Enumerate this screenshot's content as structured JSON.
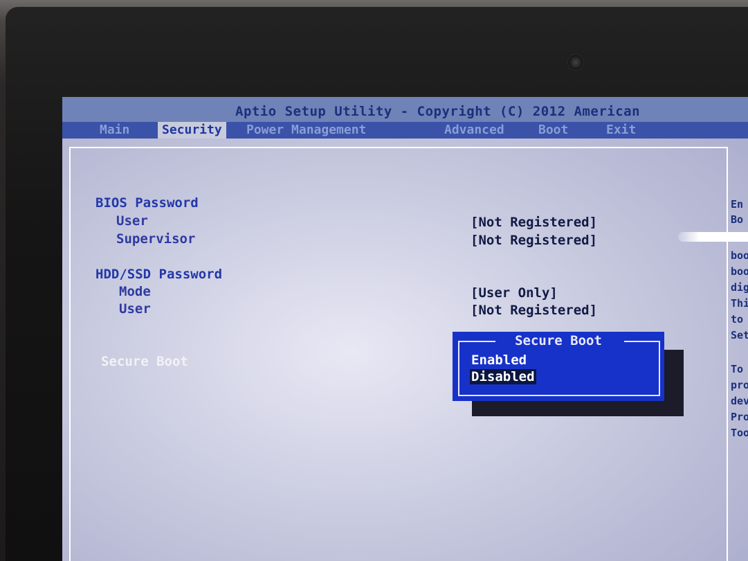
{
  "header": {
    "title": "Aptio Setup Utility - Copyright (C) 2012 American"
  },
  "tabs": [
    {
      "label": "Main",
      "active": false
    },
    {
      "label": "Security",
      "active": true
    },
    {
      "label": "Power Management",
      "active": false
    },
    {
      "label": "Advanced",
      "active": false
    },
    {
      "label": "Boot",
      "active": false
    },
    {
      "label": "Exit",
      "active": false
    }
  ],
  "security": {
    "bios_password": {
      "heading": "BIOS Password",
      "user_label": "User",
      "user_value": "[Not Registered]",
      "supervisor_label": "Supervisor",
      "supervisor_value": "[Not Registered]"
    },
    "hdd_password": {
      "heading": "HDD/SSD Password",
      "mode_label": "Mode",
      "mode_value": "[User Only]",
      "user_label": "User",
      "user_value": "[Not Registered]"
    },
    "secure_boot_label": "Secure Boot"
  },
  "popup": {
    "title": "Secure Boot",
    "options": [
      "Enabled",
      "Disabled"
    ],
    "selected": "Disabled"
  },
  "help": {
    "lines_top": [
      "En",
      "Bo"
    ],
    "lines_mid": [
      "boo",
      "boo",
      "dig",
      "Thi",
      "to",
      "Set"
    ],
    "lines_bottom": [
      "To",
      "pro",
      "dev",
      "Pro",
      "Too"
    ]
  },
  "colors": {
    "screen_bg": "#c9cbe0",
    "tab_bar": "#3a52a8",
    "label_blue": "#2238a8",
    "popup_bg": "#1732c8"
  }
}
